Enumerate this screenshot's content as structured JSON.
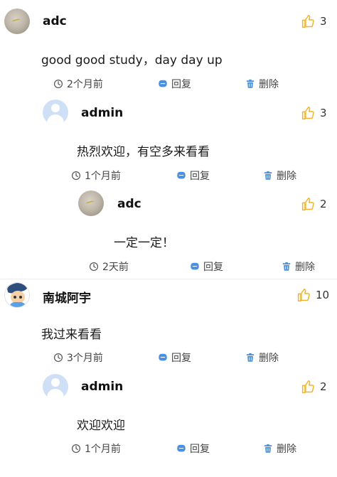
{
  "comments": [
    {
      "user": "adc",
      "avatar": "adc-avatar",
      "likes": "3",
      "content": "good good study，day day up",
      "time": "2个月前",
      "reply": "回复",
      "delete": "删除"
    },
    {
      "user": "admin",
      "avatar": "default-user-avatar",
      "likes": "3",
      "content": "热烈欢迎，有空多来看看",
      "time": "1个月前",
      "reply": "回复",
      "delete": "删除"
    },
    {
      "user": "adc",
      "avatar": "adc-avatar",
      "likes": "2",
      "content": "一定一定！",
      "time": "2天前",
      "reply": "回复",
      "delete": "删除"
    },
    {
      "user": "南城阿宇",
      "avatar": "cartoon-avatar",
      "likes": "10",
      "content": "我过来看看",
      "time": "3个月前",
      "reply": "回复",
      "delete": "删除"
    },
    {
      "user": "admin",
      "avatar": "default-user-avatar",
      "likes": "2",
      "content": "欢迎欢迎",
      "time": "1个月前",
      "reply": "回复",
      "delete": "删除"
    }
  ],
  "icons": {
    "like": "thumbs-up-icon",
    "time": "clock-icon",
    "reply": "reply-icon",
    "delete": "trash-icon"
  },
  "colors": {
    "like": "#f0b429",
    "reply": "#4a90e2",
    "delete": "#4a90e2",
    "admin_avatar": "#cfe0f6"
  }
}
